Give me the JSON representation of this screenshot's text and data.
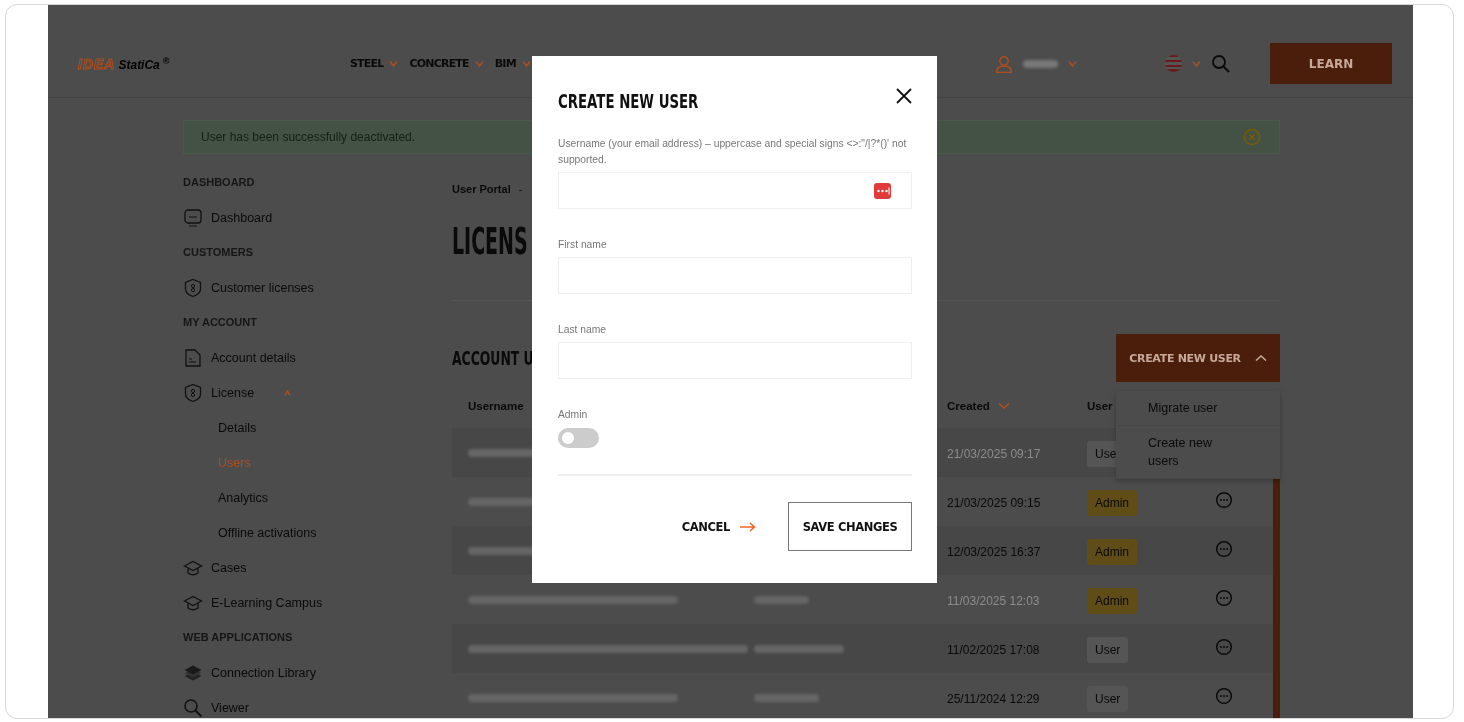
{
  "header": {
    "logo": {
      "mark": "IDEA",
      "name": "StatiCa",
      "reg": "®"
    },
    "nav": [
      {
        "label": "STEEL"
      },
      {
        "label": "CONCRETE"
      },
      {
        "label": "BIM"
      }
    ],
    "learn_button": "LEARN"
  },
  "alert": {
    "message": "User has been successfully deactivated."
  },
  "sidebar": {
    "sections": [
      {
        "title": "DASHBOARD",
        "items": [
          {
            "label": "Dashboard",
            "selected": false
          }
        ]
      },
      {
        "title": "CUSTOMERS",
        "items": [
          {
            "label": "Customer licenses",
            "selected": false
          }
        ]
      },
      {
        "title": "MY ACCOUNT",
        "items": [
          {
            "label": "Account details",
            "selected": false
          },
          {
            "label": "License",
            "selected": false,
            "expanded": true,
            "children": [
              {
                "label": "Details",
                "selected": false
              },
              {
                "label": "Users",
                "selected": true
              },
              {
                "label": "Analytics",
                "selected": false
              },
              {
                "label": "Offline activations",
                "selected": false
              }
            ]
          },
          {
            "label": "Cases",
            "selected": false
          },
          {
            "label": "E-Learning Campus",
            "selected": false
          }
        ]
      },
      {
        "title": "WEB APPLICATIONS",
        "items": [
          {
            "label": "Connection Library",
            "selected": false
          },
          {
            "label": "Viewer",
            "selected": false
          }
        ]
      }
    ]
  },
  "breadcrumb": {
    "items": [
      "User Portal"
    ],
    "separator": "-"
  },
  "page_title": "LICENS",
  "section_title": "ACCOUNT U",
  "create_button": {
    "label": "CREATE NEW USER",
    "expanded": true
  },
  "create_menu": [
    {
      "label": "Migrate user"
    },
    {
      "label": "Create new users"
    }
  ],
  "table": {
    "columns": [
      {
        "label": "Username",
        "sorted": false
      },
      {
        "label": "Created",
        "sorted": true
      },
      {
        "label": "User",
        "sorted": false
      }
    ],
    "rows": [
      {
        "created": "21/03/2025 09:17",
        "role": "Use",
        "kind": "user",
        "deactivated": true
      },
      {
        "created": "21/03/2025 09:15",
        "role": "Admin",
        "kind": "admin",
        "deactivated": false
      },
      {
        "created": "12/03/2025 16:37",
        "role": "Admin",
        "kind": "admin",
        "deactivated": false
      },
      {
        "created": "11/03/2025 12:03",
        "role": "Admin",
        "kind": "admin",
        "deactivated": true
      },
      {
        "created": "11/02/2025 17:08",
        "role": "User",
        "kind": "user",
        "deactivated": false
      },
      {
        "created": "25/11/2024 12:29",
        "role": "User",
        "kind": "user",
        "deactivated": false
      }
    ]
  },
  "modal": {
    "title": "CREATE NEW USER",
    "fields": [
      {
        "label": "Username (your email address) – uppercase and special signs <>:\"/|?*()' not supported.",
        "password_manager": true
      },
      {
        "label": "First name",
        "password_manager": false
      },
      {
        "label": "Last name",
        "password_manager": false
      }
    ],
    "admin_toggle": {
      "label": "Admin",
      "on": false
    },
    "cancel": "CANCEL",
    "save": "SAVE CHANGES"
  }
}
